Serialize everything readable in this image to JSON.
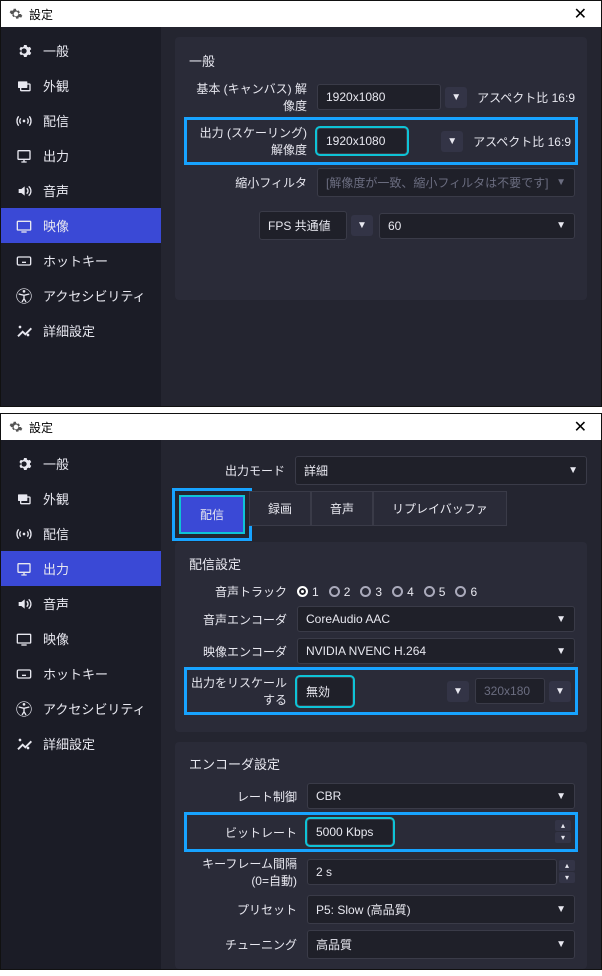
{
  "window1": {
    "title": "設定",
    "sidebar": [
      {
        "id": "general",
        "label": "一般"
      },
      {
        "id": "appearance",
        "label": "外観"
      },
      {
        "id": "stream",
        "label": "配信"
      },
      {
        "id": "output",
        "label": "出力"
      },
      {
        "id": "audio",
        "label": "音声"
      },
      {
        "id": "video",
        "label": "映像",
        "active": true
      },
      {
        "id": "hotkeys",
        "label": "ホットキー"
      },
      {
        "id": "accessibility",
        "label": "アクセシビリティ"
      },
      {
        "id": "advanced",
        "label": "詳細設定"
      }
    ],
    "section": "一般",
    "rows": {
      "base_label": "基本 (キャンバス) 解像度",
      "base_value": "1920x1080",
      "base_aspect": "アスペクト比 16:9",
      "scaled_label": "出力 (スケーリング) 解像度",
      "scaled_value": "1920x1080",
      "scaled_aspect": "アスペクト比 16:9",
      "filter_label": "縮小フィルタ",
      "filter_value": "[解像度が一致、縮小フィルタは不要です]",
      "fps_label": "FPS 共通値",
      "fps_value": "60"
    }
  },
  "window2": {
    "title": "設定",
    "sidebar": [
      {
        "id": "general",
        "label": "一般"
      },
      {
        "id": "appearance",
        "label": "外観"
      },
      {
        "id": "stream",
        "label": "配信"
      },
      {
        "id": "output",
        "label": "出力",
        "active": true
      },
      {
        "id": "audio",
        "label": "音声"
      },
      {
        "id": "video",
        "label": "映像"
      },
      {
        "id": "hotkeys",
        "label": "ホットキー"
      },
      {
        "id": "accessibility",
        "label": "アクセシビリティ"
      },
      {
        "id": "advanced",
        "label": "詳細設定"
      }
    ],
    "mode_label": "出力モード",
    "mode_value": "詳細",
    "tabs": [
      {
        "id": "stream",
        "label": "配信",
        "active": true
      },
      {
        "id": "record",
        "label": "録画"
      },
      {
        "id": "audio",
        "label": "音声"
      },
      {
        "id": "replay",
        "label": "リプレイバッファ"
      }
    ],
    "stream_section": "配信設定",
    "tracks_label": "音声トラック",
    "tracks": [
      "1",
      "2",
      "3",
      "4",
      "5",
      "6"
    ],
    "tracks_selected": 0,
    "audio_enc_label": "音声エンコーダ",
    "audio_enc_value": "CoreAudio AAC",
    "video_enc_label": "映像エンコーダ",
    "video_enc_value": "NVIDIA NVENC H.264",
    "rescale_label": "出力をリスケールする",
    "rescale_value": "無効",
    "rescale_dim": "320x180",
    "encoder_section": "エンコーダ設定",
    "rate_label": "レート制御",
    "rate_value": "CBR",
    "bitrate_label": "ビットレート",
    "bitrate_value": "5000 Kbps",
    "keyframe_label": "キーフレーム間隔 (0=自動)",
    "keyframe_value": "2 s",
    "preset_label": "プリセット",
    "preset_value": "P5: Slow (高品質)",
    "tuning_label": "チューニング",
    "tuning_value": "高品質"
  }
}
